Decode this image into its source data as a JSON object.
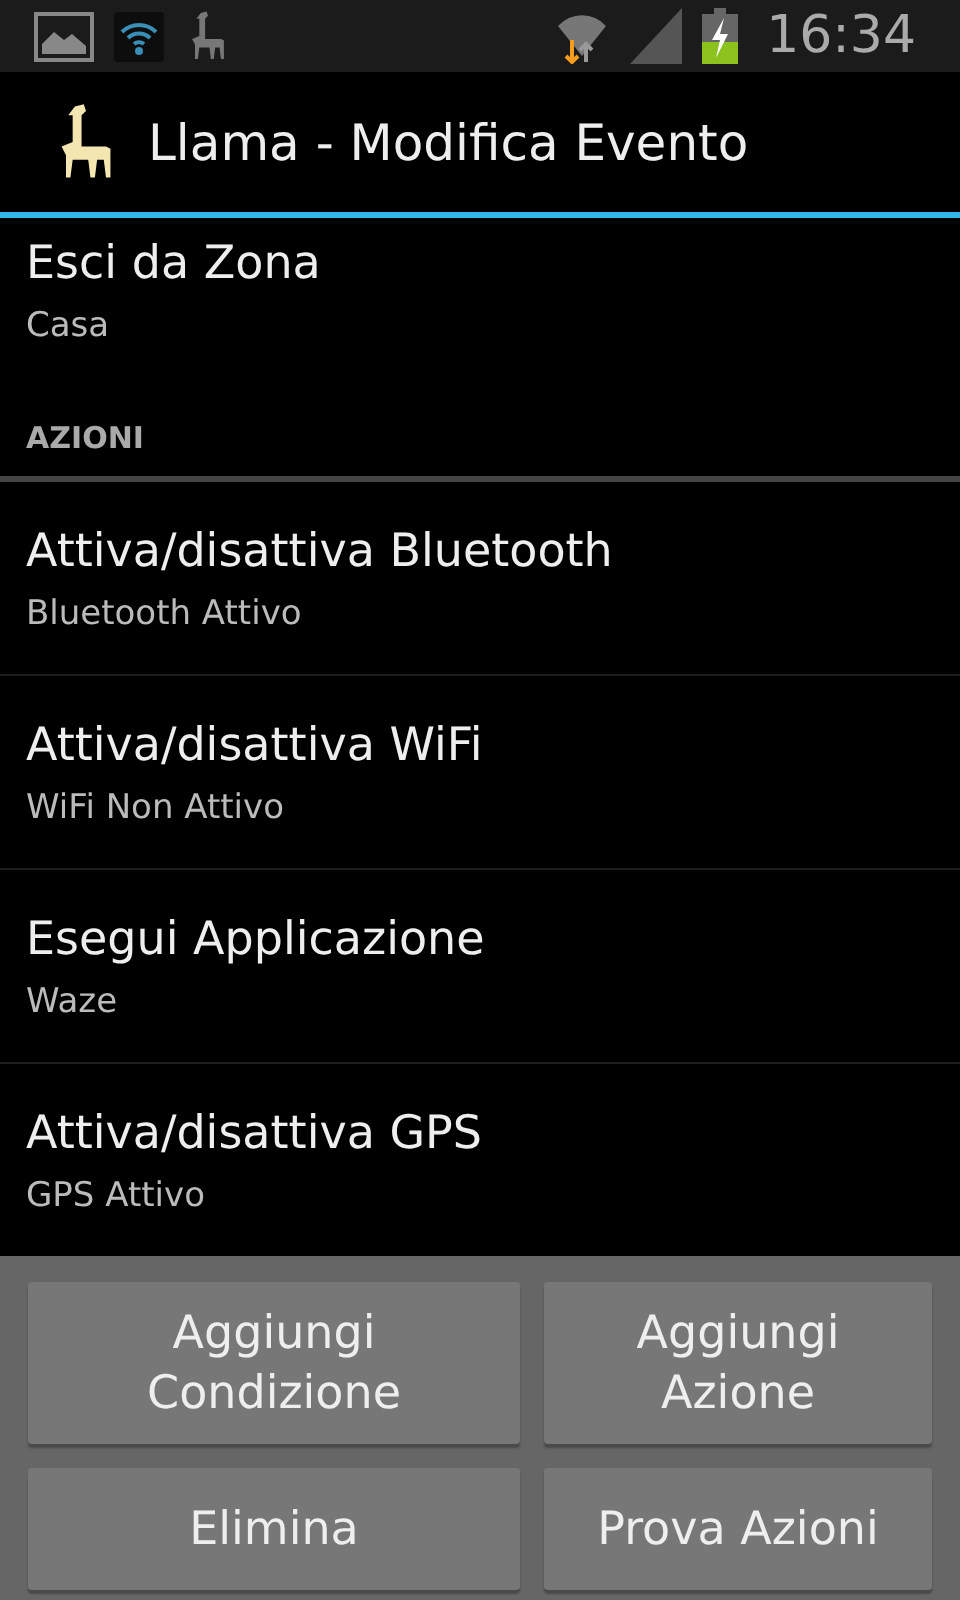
{
  "status_bar": {
    "time": "16:34"
  },
  "action_bar": {
    "title": "Llama - Modifica Evento"
  },
  "condition": {
    "title": "Esci da Zona",
    "subtitle": "Casa"
  },
  "section": {
    "title": "AZIONI"
  },
  "actions": [
    {
      "title": "Attiva/disattiva Bluetooth",
      "subtitle": "Bluetooth Attivo"
    },
    {
      "title": "Attiva/disattiva WiFi",
      "subtitle": "WiFi Non Attivo"
    },
    {
      "title": "Esegui Applicazione",
      "subtitle": "Waze"
    },
    {
      "title": "Attiva/disattiva GPS",
      "subtitle": "GPS Attivo"
    }
  ],
  "buttons": [
    "Aggiungi Condizione",
    "Aggiungi Azione",
    "Elimina",
    "Prova Azioni"
  ]
}
